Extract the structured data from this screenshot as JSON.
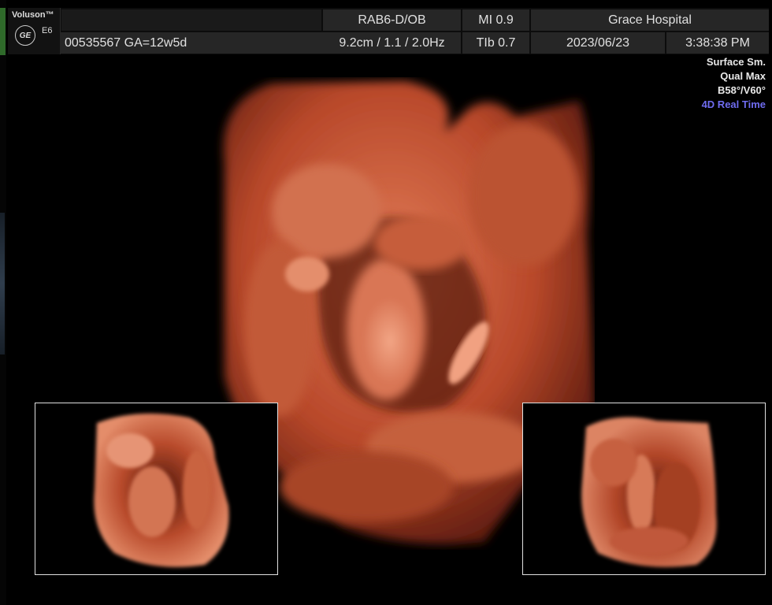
{
  "header": {
    "brand": "Voluson™",
    "model": "E6",
    "logo": "GE",
    "probe": "RAB6-D/OB",
    "mi": "MI  0.9",
    "hospital": "Grace Hospital",
    "patient": "00535567  GA=12w5d",
    "depth": "9.2cm / 1.1 / 2.0Hz",
    "tib": "TIb  0.7",
    "date": "2023/06/23",
    "time": "3:38:38 PM"
  },
  "info": {
    "line1": "Surface Sm.",
    "line2": "Qual Max",
    "line3": "B58°/V60°",
    "mode": "4D Real Time"
  },
  "colors": {
    "accent": "#6f6cf0",
    "render_base": "#c0532f",
    "render_highlight": "#ef9a79"
  },
  "views": [
    "main-4d-render",
    "left-inset-render",
    "right-inset-render"
  ]
}
